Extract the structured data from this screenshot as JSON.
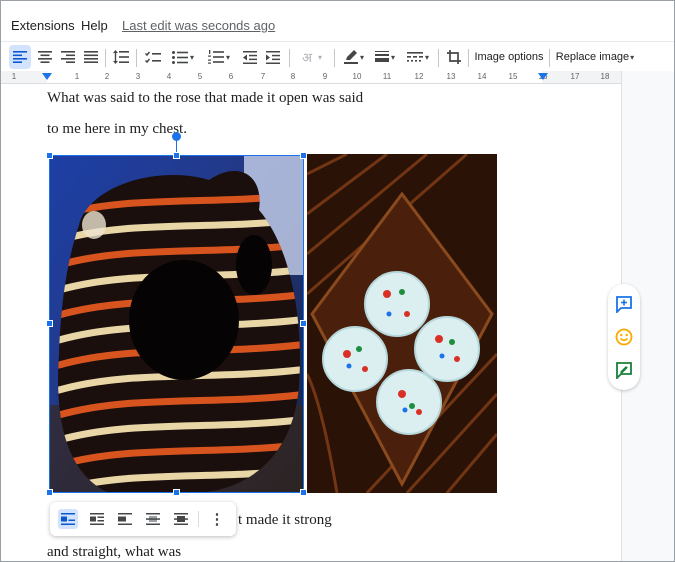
{
  "menu": {
    "extensions": "Extensions",
    "help": "Help",
    "last_edit": "Last edit was seconds ago"
  },
  "toolbar": {
    "input_tools_glyph": "अ",
    "image_options": "Image options",
    "replace_image": "Replace image",
    "caret": "▾",
    "icons": [
      "align-left-icon",
      "align-center-icon",
      "align-right-icon",
      "justify-icon",
      "line-spacing-icon",
      "checklist-icon",
      "bulleted-list-icon",
      "numbered-list-icon",
      "decrease-indent-icon",
      "increase-indent-icon",
      "input-tools-icon",
      "border-color-icon",
      "border-weight-icon",
      "border-dash-icon",
      "crop-icon"
    ]
  },
  "ruler": {
    "labels": [
      "1",
      "1",
      "2",
      "3",
      "4",
      "5",
      "6",
      "7",
      "8",
      "9",
      "10",
      "11",
      "12",
      "13",
      "14",
      "15",
      "16",
      "17",
      "18"
    ]
  },
  "document": {
    "line1": "What was said to the rose that made it open was said",
    "line2": "to me here in my chest.",
    "line3": "t made it strong",
    "line4": "and straight, what was"
  },
  "image_toolbar": {
    "icons": [
      "in-line-icon",
      "wrap-text-icon",
      "break-text-icon",
      "behind-text-icon",
      "in-front-of-text-icon",
      "more-options-icon"
    ],
    "more_glyph": "⋮"
  },
  "side_tools": {
    "icons": [
      "add-comment-icon",
      "emoji-reaction-icon",
      "suggest-edits-icon"
    ]
  },
  "images": {
    "left": "striped-ceramic-pot-photo",
    "right": "wooden-tray-with-coasters-photo"
  },
  "colors": {
    "accent": "#1a73e8",
    "active_bg": "#d3e3fd",
    "emoji_yellow": "#f9ab00",
    "suggest_green": "#188038"
  }
}
